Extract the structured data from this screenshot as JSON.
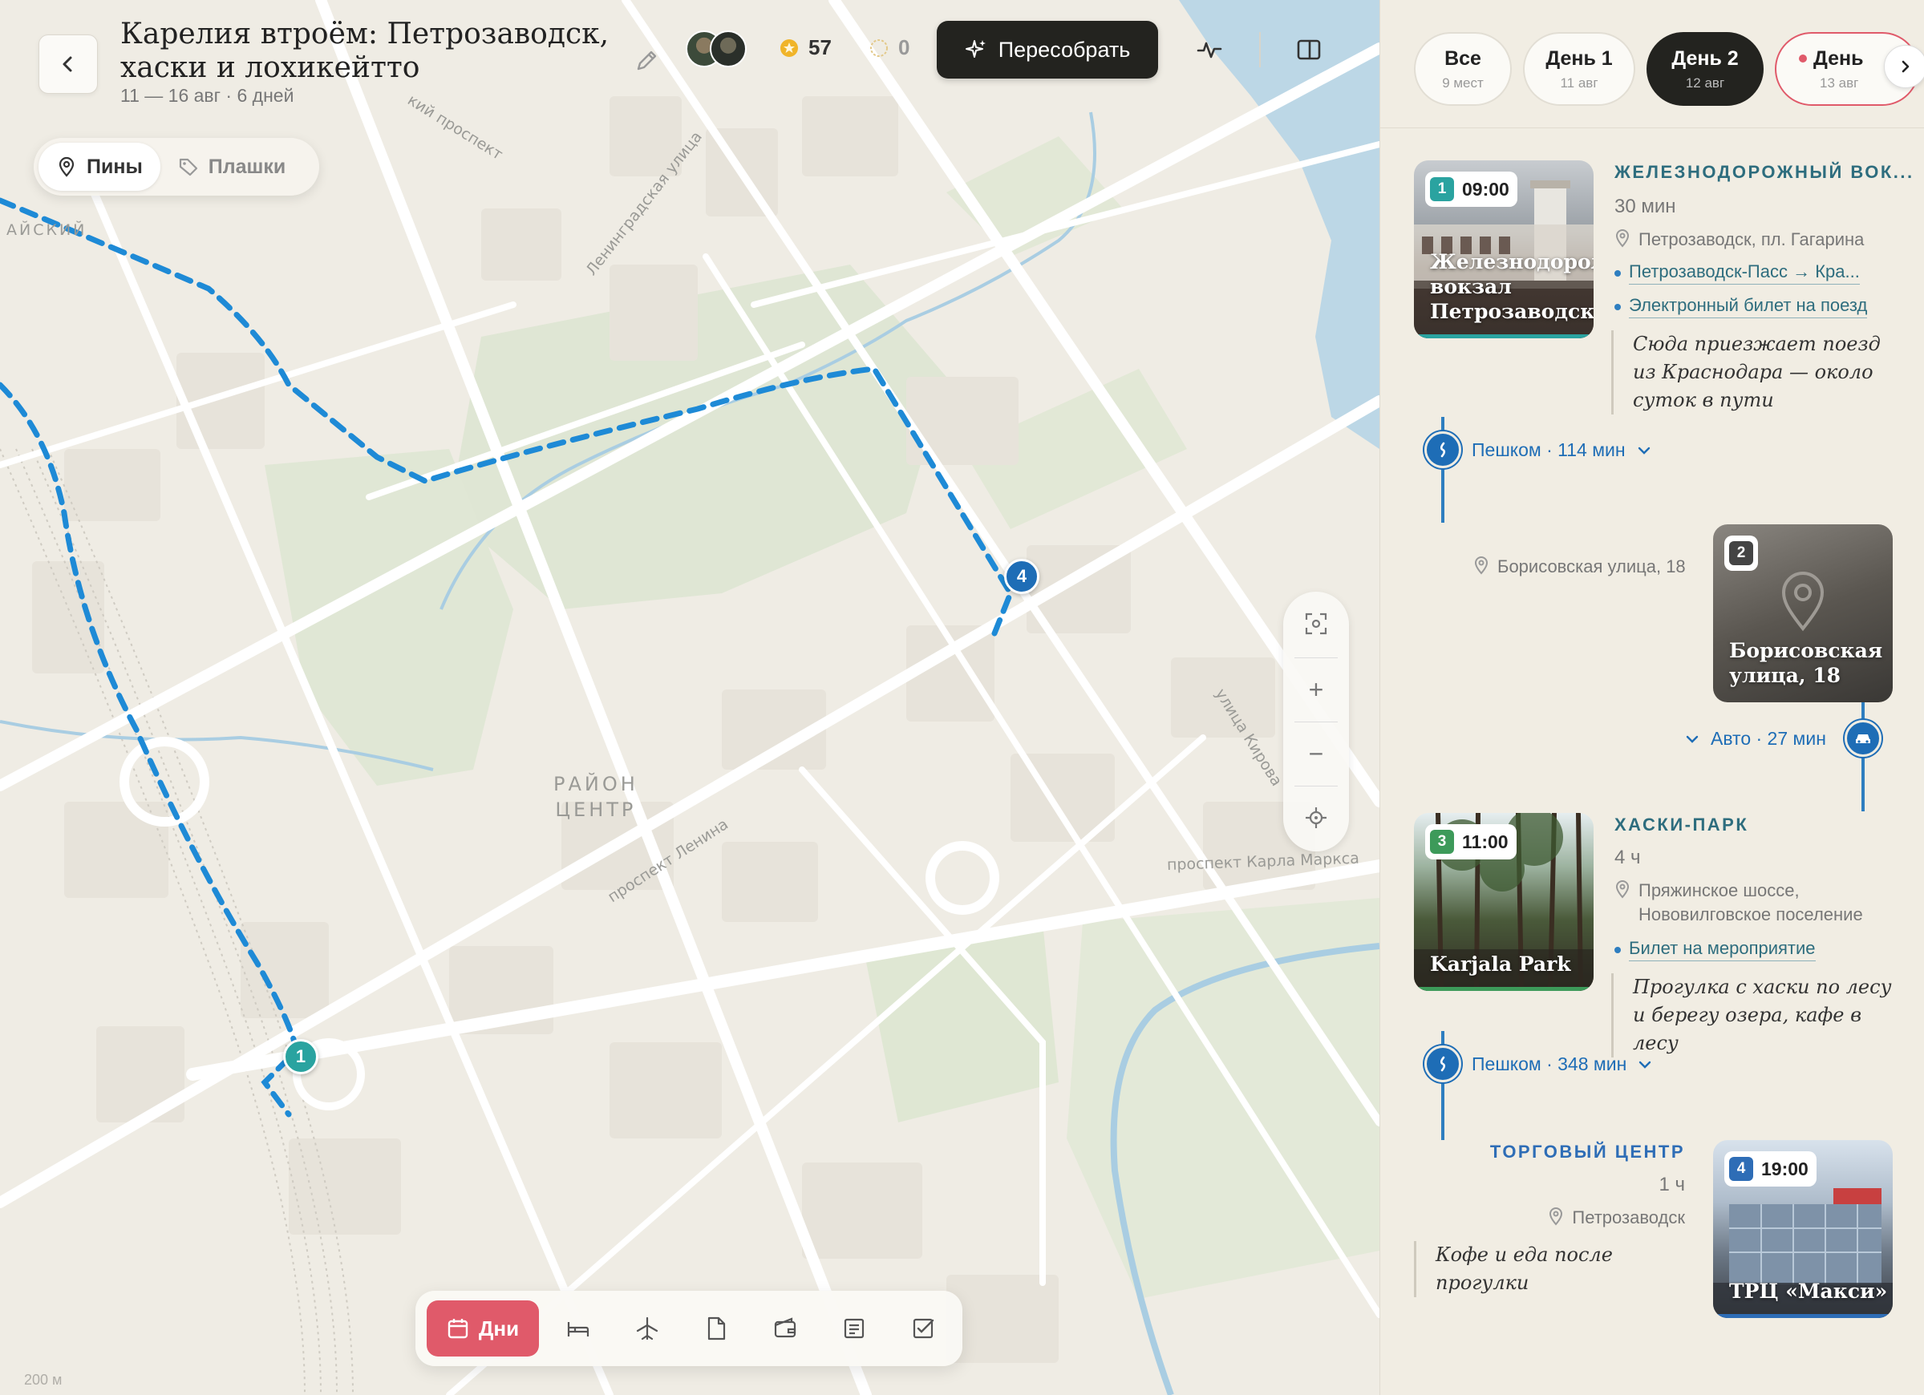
{
  "trip": {
    "title_line1": "Карелия втроём: Петрозаводск,",
    "title_line2": "хаски и лохикейтто",
    "dates": "11 — 16 авг · 6 дней",
    "likes": "57",
    "rating": "0"
  },
  "toolbar": {
    "rebuild_label": "Пересобрать"
  },
  "map": {
    "toggle": [
      {
        "label": "Пины",
        "active": true
      },
      {
        "label": "Плашки",
        "active": false
      }
    ],
    "district_line1": "РАЙОН",
    "district_line2": "ЦЕНТР",
    "street_labels": [
      "Ленинградская улица",
      "улица Кирова",
      "проспект Ленина",
      "проспект Карла Маркса",
      "кий проспект",
      "АЙСКИЙ"
    ],
    "scale": "200 м",
    "markers": [
      "1",
      "4"
    ],
    "zoom_in": "+",
    "zoom_out": "−"
  },
  "dock": {
    "days_label": "Дни",
    "icons": [
      "bed-icon",
      "plane-icon",
      "document-icon",
      "wallet-icon",
      "notes-icon",
      "checklist-icon"
    ]
  },
  "tabs": [
    {
      "label": "Все",
      "sub": "9 мест"
    },
    {
      "label": "День 1",
      "sub": "11 авг"
    },
    {
      "label": "День 2",
      "sub": "12 авг"
    },
    {
      "label": "День",
      "sub": "13 авг"
    }
  ],
  "places": [
    {
      "num": "1",
      "time": "09:00",
      "image_caption": "Железнодорожный вокзал Петрозаводска",
      "title": "ЖЕЛЕЗНОДОРОЖНЫЙ ВОК...",
      "duration": "30 мин",
      "address": "Петрозаводск, пл. Гагарина",
      "links": [
        "Петрозаводск-Пасс → Кра...",
        "Электронный билет на поезд"
      ],
      "note": "Сюда приезжает поезд из Краснодара — около суток в пути",
      "bar_color": "#2aa3a0"
    },
    {
      "num": "2",
      "image_caption": "Борисовская улица, 18",
      "address": "Борисовская улица, 18"
    },
    {
      "num": "3",
      "time": "11:00",
      "image_caption": "Karjala Park",
      "title": "ХАСКИ-ПАРК",
      "duration": "4 ч",
      "address": "Пряжинское шоссе, Нововилговское поселение",
      "links": [
        "Билет на мероприятие"
      ],
      "note": "Прогулка с хаски по лесу и берегу озера, кафе в лесу",
      "bar_color": "#3d9a5a"
    },
    {
      "num": "4",
      "time": "19:00",
      "image_caption": "ТРЦ «Макси»",
      "title": "ТОРГОВЫЙ ЦЕНТР",
      "duration": "1 ч",
      "address": "Петрозаводск",
      "note": "Кофе и еда после прогулки",
      "bar_color": "#2e6db6"
    }
  ],
  "transfers": [
    {
      "label": "Пешком · 114 мин"
    },
    {
      "label": "Авто · 27 мин"
    },
    {
      "label": "Пешком · 348 мин"
    }
  ]
}
